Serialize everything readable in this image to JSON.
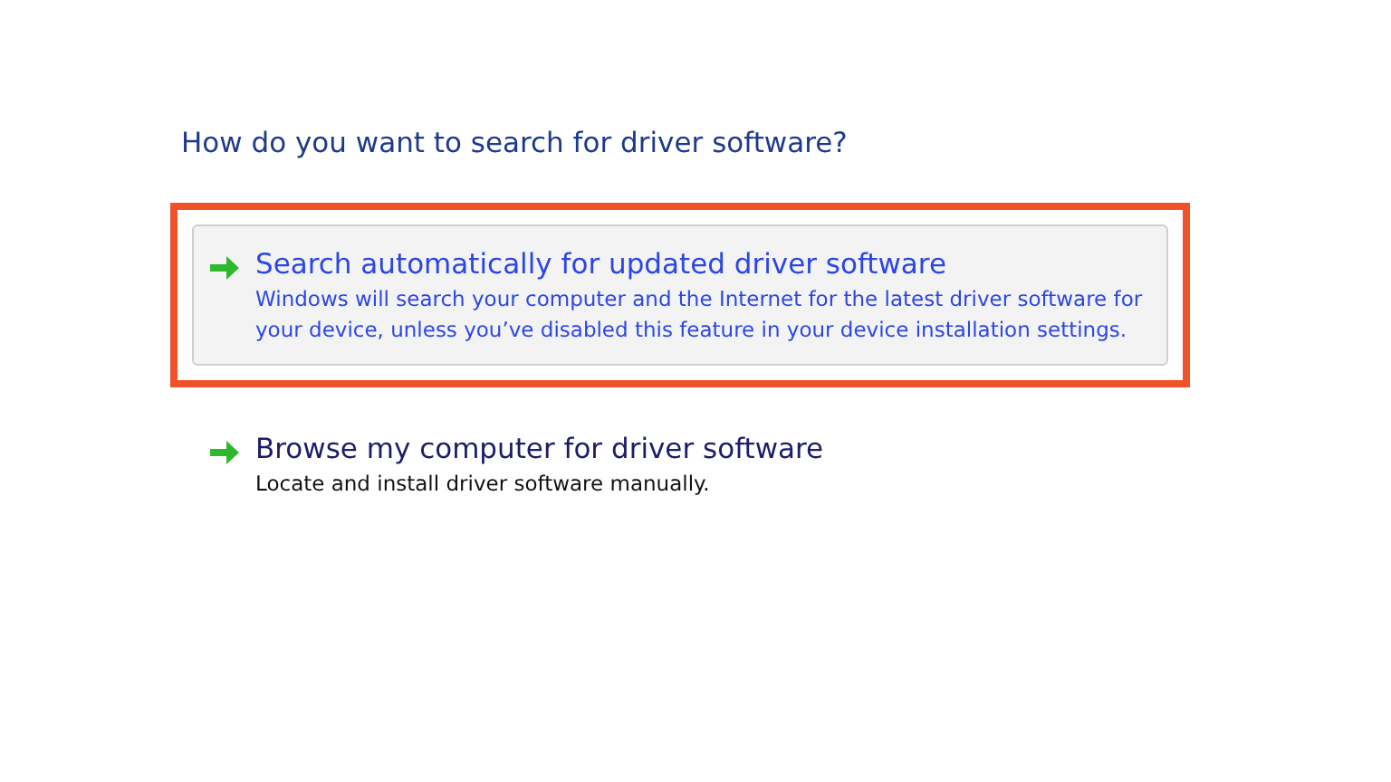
{
  "heading": "How do you want to search for driver software?",
  "options": [
    {
      "title": "Search automatically for updated driver software",
      "description": "Windows will search your computer and the Internet for the latest driver software for your device, unless you’ve disabled this feature in your device installation settings.",
      "selected": true,
      "highlighted": true
    },
    {
      "title": "Browse my computer for driver software",
      "description": "Locate and install driver software manually.",
      "selected": false,
      "highlighted": false
    }
  ]
}
